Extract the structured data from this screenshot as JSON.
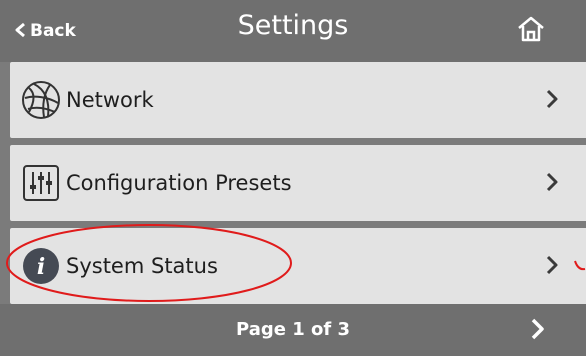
{
  "header": {
    "back_label": "Back",
    "back_icon": "chevron-left-icon",
    "title": "Settings",
    "home_icon": "home-icon"
  },
  "menu": {
    "items": [
      {
        "label": "Network",
        "icon": "globe-icon",
        "arrow_icon": "chevron-right-icon"
      },
      {
        "label": "Configuration Presets",
        "icon": "sliders-icon",
        "arrow_icon": "chevron-right-icon"
      },
      {
        "label": "System Status",
        "icon": "info-icon",
        "arrow_icon": "chevron-right-icon"
      }
    ]
  },
  "footer": {
    "page_label": "Page 1 of 3",
    "next_icon": "chevron-right-icon"
  },
  "colors": {
    "bar_gray": "#6f6f6f",
    "row_gray": "#e3e3e3",
    "annotation_red": "#e01b1b"
  }
}
